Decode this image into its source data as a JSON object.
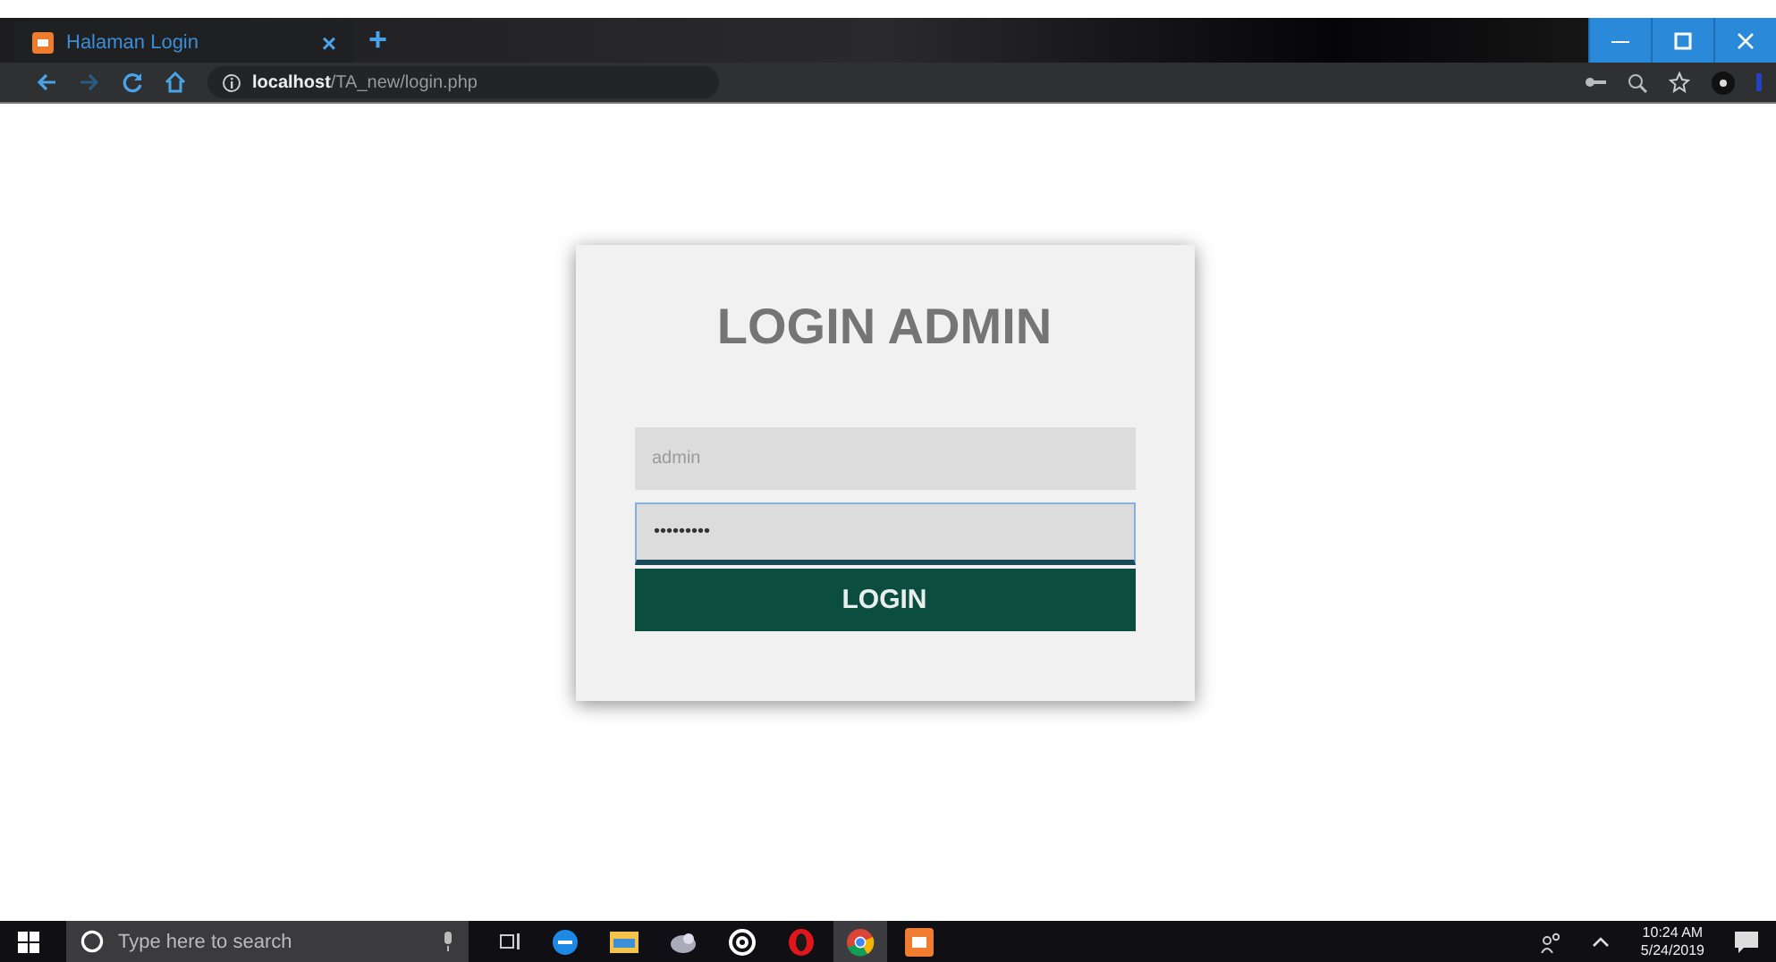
{
  "browser": {
    "tab": {
      "title": "Halaman Login",
      "close": "×"
    },
    "new_tab": "+",
    "url_host": "localhost",
    "url_path": "/TA_new/login.php"
  },
  "login": {
    "title": "LOGIN ADMIN",
    "username": {
      "placeholder": "admin"
    },
    "password": {
      "value": "•••••••••",
      "focused": true
    },
    "button": "LOGIN"
  },
  "taskbar": {
    "search_placeholder": "Type here to search",
    "time": "10:24 AM",
    "date": "5/24/2019"
  }
}
